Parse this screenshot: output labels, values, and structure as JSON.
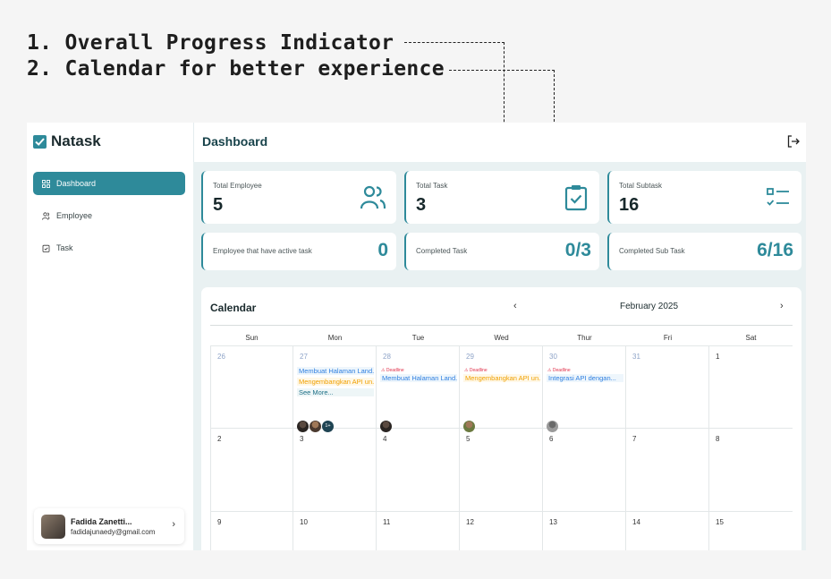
{
  "annotations": [
    "1. Overall Progress Indicator",
    "2. Calendar for better experience"
  ],
  "app": {
    "brand": "Natask",
    "page_title": "Dashboard",
    "nav": [
      {
        "label": "Dashboard",
        "icon": "grid-icon",
        "active": true
      },
      {
        "label": "Employee",
        "icon": "users-icon",
        "active": false
      },
      {
        "label": "Task",
        "icon": "clipboard-icon",
        "active": false
      }
    ],
    "user": {
      "name": "Fadida Zanetti...",
      "email": "fadidajunaedy@gmail.com"
    },
    "accent": "#2e8a9a"
  },
  "stats": {
    "total_employee": {
      "label": "Total Employee",
      "value": "5"
    },
    "total_task": {
      "label": "Total Task",
      "value": "3"
    },
    "total_subtask": {
      "label": "Total Subtask",
      "value": "16"
    },
    "active_employee": {
      "label": "Employee that have active task",
      "value": "0"
    },
    "completed_task": {
      "label": "Completed Task",
      "value": "0/3"
    },
    "completed_subtask": {
      "label": "Completed Sub Task",
      "value": "6/16"
    }
  },
  "calendar": {
    "title": "Calendar",
    "month": "February 2025",
    "prev": "‹",
    "next": "›",
    "days": [
      "Sun",
      "Mon",
      "Tue",
      "Wed",
      "Thur",
      "Fri",
      "Sat"
    ],
    "rows": [
      [
        "26",
        "27",
        "28",
        "29",
        "30",
        "31",
        "1"
      ],
      [
        "2",
        "3",
        "4",
        "5",
        "6",
        "7",
        "8"
      ],
      [
        "9",
        "10",
        "11",
        "12",
        "13",
        "14",
        "15"
      ]
    ],
    "events": {
      "mon_1": "Membuat Halaman Land...",
      "mon_2": "Mengembangkan API un...",
      "mon_more": "See More...",
      "tue_1": "Membuat Halaman Land...",
      "wed_1": "Mengembangkan API un...",
      "thu_1": "Integrasi API dengan...",
      "deadline": "⚠ Deadline",
      "avatar_more": "1+"
    }
  }
}
